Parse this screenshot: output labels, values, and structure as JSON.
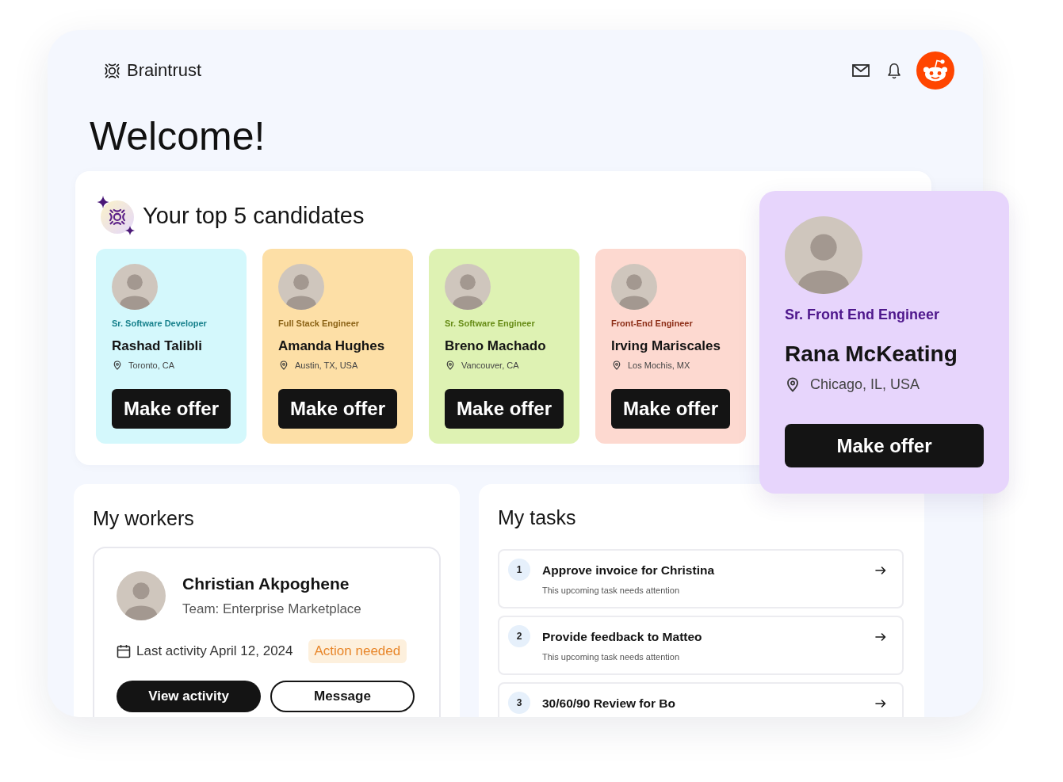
{
  "header": {
    "brand": "Braintrust"
  },
  "page_title": "Welcome!",
  "candidates": {
    "title": "Your top 5 candidates",
    "items": [
      {
        "kind": "card",
        "role": "Sr. Software Developer",
        "name": "Rashad Talibli",
        "location": "Toronto, CA",
        "button": "Make offer",
        "color": "#d4f8fc"
      },
      {
        "kind": "card",
        "role": "Full Stack Engineer",
        "name": "Amanda Hughes",
        "location": "Austin, TX, USA",
        "button": "Make offer",
        "color": "#fddfa6"
      },
      {
        "kind": "card",
        "role": "Sr. Software Engineer",
        "name": "Breno Machado",
        "location": "Vancouver, CA",
        "button": "Make offer",
        "color": "#def2b3"
      },
      {
        "kind": "card",
        "role": "Front-End Engineer",
        "name": "Irving Mariscales",
        "location": "Los Mochis, MX",
        "button": "Make offer",
        "color": "#fdd9d0"
      },
      {
        "kind": "featured",
        "role": "Sr. Front End Engineer",
        "name": "Rana McKeating",
        "location": "Chicago, IL, USA",
        "button": "Make offer",
        "color": "#e7d5fc"
      }
    ]
  },
  "workers": {
    "title": "My workers",
    "items": [
      {
        "name": "Christian Akpoghene",
        "team": "Team: Enterprise Marketplace",
        "last_activity": "Last activity April 12, 2024",
        "badge": "Action needed",
        "buttons": [
          {
            "label": "View activity",
            "kind": "primary"
          },
          {
            "label": "Message",
            "kind": "secondary"
          }
        ]
      }
    ]
  },
  "tasks": {
    "title": "My tasks",
    "items": [
      {
        "number": "1",
        "title": "Approve invoice for Christina",
        "subtitle": "This upcoming task needs attention"
      },
      {
        "number": "2",
        "title": "Provide feedback to Matteo",
        "subtitle": "This upcoming task needs attention"
      },
      {
        "number": "3",
        "title": "30/60/90 Review for Bo"
      }
    ]
  }
}
